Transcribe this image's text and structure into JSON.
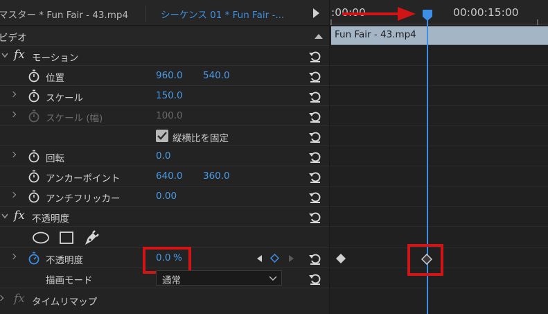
{
  "tabs": {
    "master": "マスター * Fun Fair - 43.mp4",
    "sequence": "シーケンス 01 * Fun Fair -..."
  },
  "section": {
    "title": "ビデオ"
  },
  "motion": {
    "title": "モーション",
    "position": {
      "label": "位置",
      "x": "960.0",
      "y": "540.0"
    },
    "scale": {
      "label": "スケール",
      "value": "150.0"
    },
    "scale_width": {
      "label": "スケール (幅)",
      "value": "100.0"
    },
    "uniform_scale": {
      "label": "縦横比を固定",
      "checked": true
    },
    "rotation": {
      "label": "回転",
      "value": "0.0"
    },
    "anchor": {
      "label": "アンカーポイント",
      "x": "640.0",
      "y": "360.0"
    },
    "antiflicker": {
      "label": "アンチフリッカー",
      "value": "0.00"
    }
  },
  "opacity": {
    "title": "不透明度",
    "opacity_label": "不透明度",
    "value": "0.0",
    "unit": "%",
    "blend_label": "描画モード",
    "blend_value": "通常"
  },
  "timeremap": {
    "title": "タイムリマップ"
  },
  "timeline": {
    "start_tc": ":00:00",
    "end_tc": "00:00:15:00",
    "clip_name": "Fun Fair - 43.mp4"
  },
  "colors": {
    "accent": "#3d8fe6",
    "highlight": "#d11416",
    "clip": "#a4b5c6"
  },
  "icons": [
    "stopwatch-icon",
    "reset-icon",
    "ellipse-mask-icon",
    "rect-mask-icon",
    "pen-mask-icon",
    "keyframe-icon",
    "playhead-icon",
    "arrow-icon"
  ]
}
